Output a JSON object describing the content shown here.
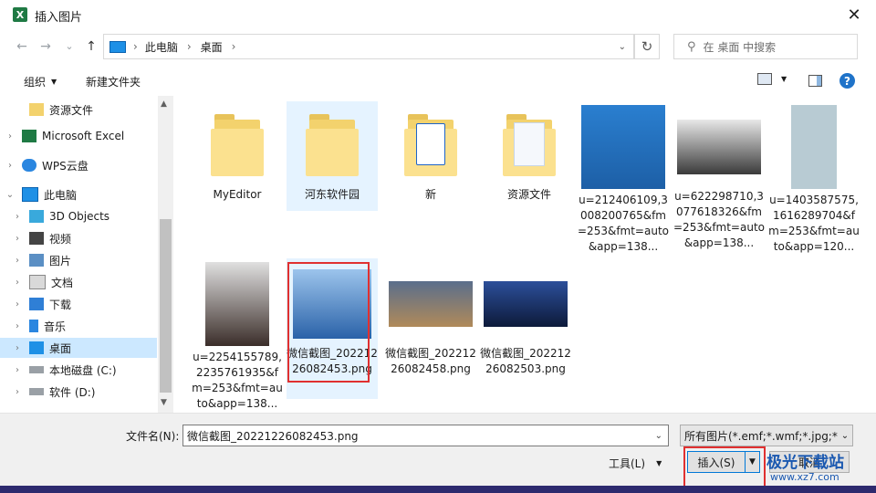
{
  "window": {
    "title": "插入图片",
    "app_icon_letter": "X",
    "close_symbol": "✕"
  },
  "nav": {
    "back": "←",
    "forward": "→",
    "history": "⌄",
    "up": "↑",
    "breadcrumb": [
      "此电脑",
      "桌面"
    ],
    "separator": "›",
    "search_placeholder": "在 桌面 中搜索",
    "refresh": "↻"
  },
  "toolbar": {
    "organize": "组织",
    "new_folder": "新建文件夹",
    "help": "?"
  },
  "sidebar": {
    "items": [
      {
        "label": "资源文件",
        "icon": "folder-icon",
        "indent": 2,
        "chevron": ""
      },
      {
        "label": "Microsoft Excel",
        "icon": "excel-icon",
        "indent": 1,
        "chevron": "›"
      },
      {
        "label": "WPS云盘",
        "icon": "cloud-icon",
        "indent": 1,
        "chevron": "›"
      },
      {
        "label": "此电脑",
        "icon": "pc-icon",
        "indent": 1,
        "chevron": "⌄"
      },
      {
        "label": "3D Objects",
        "icon": "cube-icon",
        "indent": 2,
        "chevron": "›"
      },
      {
        "label": "视频",
        "icon": "video-icon",
        "indent": 2,
        "chevron": "›"
      },
      {
        "label": "图片",
        "icon": "picture-icon",
        "indent": 2,
        "chevron": "›"
      },
      {
        "label": "文档",
        "icon": "document-icon",
        "indent": 2,
        "chevron": "›"
      },
      {
        "label": "下载",
        "icon": "download-icon",
        "indent": 2,
        "chevron": "›"
      },
      {
        "label": "音乐",
        "icon": "music-icon",
        "indent": 2,
        "chevron": "›"
      },
      {
        "label": "桌面",
        "icon": "desktop-icon",
        "indent": 2,
        "chevron": "›",
        "selected": true
      },
      {
        "label": "本地磁盘 (C:)",
        "icon": "drive-icon",
        "indent": 2,
        "chevron": "›"
      },
      {
        "label": "软件 (D:)",
        "icon": "drive-icon",
        "indent": 2,
        "chevron": "›"
      }
    ]
  },
  "files": [
    {
      "name": "MyEditor",
      "kind": "folder"
    },
    {
      "name": "河东软件园",
      "kind": "folder",
      "state": "hover"
    },
    {
      "name": "新",
      "kind": "folder-doc"
    },
    {
      "name": "资源文件",
      "kind": "folder-pages"
    },
    {
      "name": "u=212406109,3008200765&fm=253&fmt=auto&app=138...",
      "kind": "photo-portrait"
    },
    {
      "name": "u=622298710,3077618326&fm=253&fmt=auto&app=138...",
      "kind": "photo-rock"
    },
    {
      "name": "u=1403587575,1616289704&fm=253&fmt=auto&app=120...",
      "kind": "photo-pug"
    },
    {
      "name": "u=2254155789,2235761935&fm=253&fmt=auto&app=138...",
      "kind": "photo-girl"
    },
    {
      "name": "微信截图_20221226082453.png",
      "kind": "photo-bridge",
      "state": "selected"
    },
    {
      "name": "微信截图_20221226082458.png",
      "kind": "photo-city"
    },
    {
      "name": "微信截图_20221226082503.png",
      "kind": "photo-night"
    }
  ],
  "bottom": {
    "filename_label": "文件名(N):",
    "filename_value": "微信截图_20221226082453.png",
    "filetype_value": "所有图片(*.emf;*.wmf;*.jpg;*.jp",
    "tools": "工具(L)",
    "insert": "插入(S)",
    "cancel": "取消"
  },
  "watermark": {
    "text": "极光下载站",
    "url": "www.xz7.com"
  },
  "colors": {
    "selection": "#cce8ff",
    "highlight": "#e03030",
    "accent": "#0078d7"
  }
}
